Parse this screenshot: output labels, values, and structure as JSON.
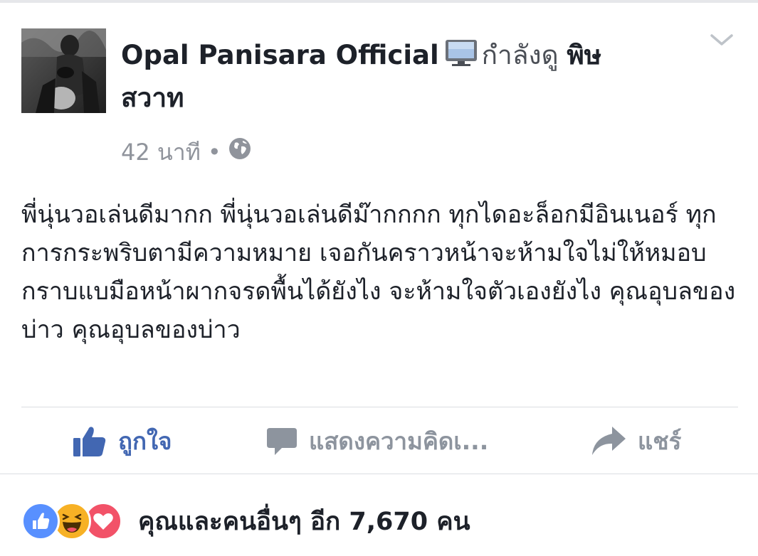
{
  "header": {
    "author": "Opal Panisara Official",
    "activity": "กำลังดู",
    "show_title": "พิษสวาท",
    "time": "42 นาที",
    "separator": "•"
  },
  "post": {
    "text": "พี่นุ่นวอเล่นดีมากก พี่นุ่นวอเล่นดีม๊ากกกก ทุกไดอะล็อกมีอินเนอร์ ทุกการกระพริบตามีความหมาย เจอกันคราวหน้าจะห้ามใจไม่ให้หมอบกราบแบมือหน้าผากจรดพื้นได้ยังไง จะห้ามใจตัวเองยังไง คุณอุบลของบ่าว คุณอุบลของบ่าว"
  },
  "actions": {
    "like": "ถูกใจ",
    "comment": "แสดงความคิดเ...",
    "share": "แชร์"
  },
  "reactions": {
    "summary": "คุณและคนอื่นๆ อีก 7,670 คน",
    "icons": [
      "like-reaction-icon",
      "haha-reaction-icon",
      "love-reaction-icon"
    ]
  },
  "colors": {
    "facebook_blue": "#4267b2",
    "muted_gray": "#90949c",
    "like_reaction": "#5890ff",
    "haha_reaction": "#f7b125",
    "love_reaction": "#f25268"
  }
}
